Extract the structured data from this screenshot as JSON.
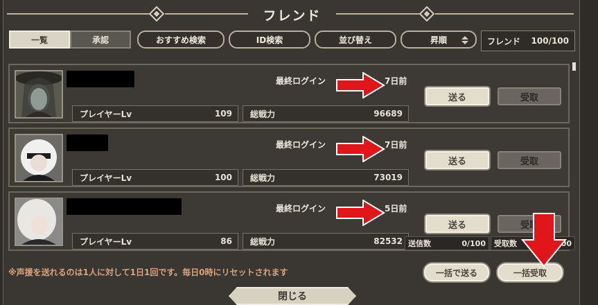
{
  "header": {
    "title": "フレンド"
  },
  "tabs": [
    {
      "label": "一覧",
      "active": true
    },
    {
      "label": "承認",
      "active": false
    }
  ],
  "filters": {
    "recommend_search": "おすすめ検索",
    "id_search": "ID検索",
    "sort": "並び替え",
    "order": "昇順"
  },
  "friend_count": {
    "label": "フレンド",
    "value": "100/100"
  },
  "friends": [
    {
      "last_login_label": "最終ログイン",
      "last_login": "7日前",
      "player_lv_label": "プレイヤーLv",
      "player_lv": "109",
      "power_label": "総戦力",
      "power": "96689",
      "send_label": "送る",
      "receive_label": "受取"
    },
    {
      "last_login_label": "最終ログイン",
      "last_login": "7日前",
      "player_lv_label": "プレイヤーLv",
      "player_lv": "100",
      "power_label": "総戦力",
      "power": "73019",
      "send_label": "送る",
      "receive_label": "受取"
    },
    {
      "last_login_label": "最終ログイン",
      "last_login": "5日前",
      "player_lv_label": "プレイヤーLv",
      "player_lv": "86",
      "power_label": "総戦力",
      "power": "82532",
      "send_label": "送る",
      "receive_label": "受取"
    }
  ],
  "counters": {
    "sent_label": "送信数",
    "sent_value": "0/100",
    "received_label": "受取数",
    "received_value": "0/100"
  },
  "notice": "※声援を送れるのは1人に対して1日1回です。毎日0時にリセットされます",
  "bulk": {
    "send_all": "一括で送る",
    "receive_all": "一括受取"
  },
  "footer": {
    "close_label": "閉じる"
  },
  "colors": {
    "arrow_red": "#e0161a",
    "notice": "#d9a27f",
    "panel": "#3a3733"
  },
  "icons": [
    "diamond-ornament-icon",
    "sort-updown-icon",
    "red-arrow-right-icon",
    "red-arrow-down-icon"
  ]
}
